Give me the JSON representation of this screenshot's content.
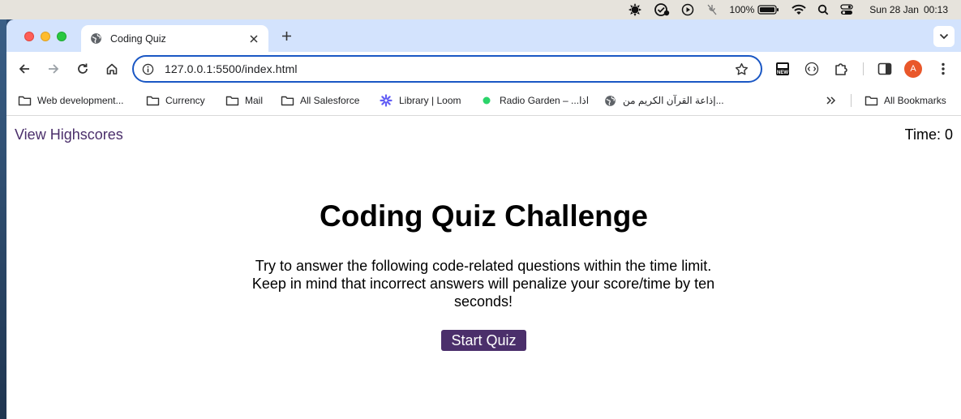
{
  "menubar": {
    "battery_percent": "100%",
    "date": "Sun 28 Jan",
    "time": "00:13"
  },
  "browser": {
    "tab": {
      "title": "Coding Quiz"
    },
    "address_bar": {
      "url": "127.0.0.1:5500/index.html"
    },
    "profile_initial": "A",
    "bookmarks": [
      {
        "label": "Web development...",
        "icon": "folder-icon"
      },
      {
        "label": "Currency",
        "icon": "folder-icon"
      },
      {
        "label": "Mail",
        "icon": "folder-icon"
      },
      {
        "label": "All Salesforce",
        "icon": "folder-icon"
      },
      {
        "label": "Library | Loom",
        "icon": "loom-icon"
      },
      {
        "label": "Radio Garden – ...اذا",
        "icon": "radio-garden-icon"
      },
      {
        "label": "إذاعة القرآن الكريم من...",
        "icon": "globe-icon"
      }
    ],
    "all_bookmarks_label": "All Bookmarks",
    "colors": {
      "tabstrip": "#d3e3fd",
      "omnibox_border": "#1a57c4"
    }
  },
  "page": {
    "highscores_link": "View Highscores",
    "timer_label": "Time: ",
    "timer_value": "0",
    "title": "Coding Quiz Challenge",
    "intro": "Try to answer the following code-related questions within the time limit. Keep in mind that incorrect answers will penalize your score/time by ten seconds!",
    "start_button": "Start Quiz",
    "colors": {
      "accent": "#4b2f6b"
    }
  }
}
